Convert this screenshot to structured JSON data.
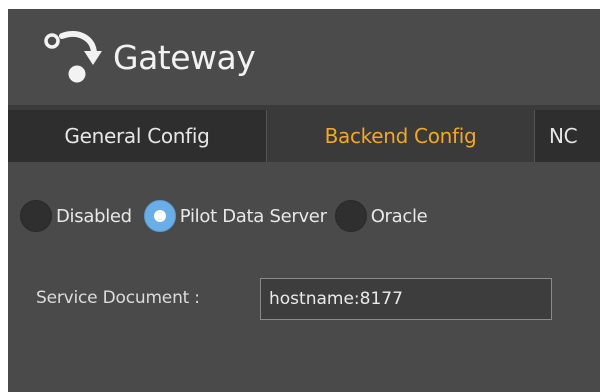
{
  "app": {
    "title": "Gateway",
    "logo_icon": "gateway-arrow-icon"
  },
  "tabs": [
    {
      "label": "General Config",
      "active": false
    },
    {
      "label": "Backend Config",
      "active": true
    },
    {
      "label": "NC",
      "active": false
    }
  ],
  "backend": {
    "mode_options": [
      {
        "label": "Disabled",
        "checked": false
      },
      {
        "label": "Pilot Data Server",
        "checked": true
      },
      {
        "label": "Oracle",
        "checked": false
      }
    ],
    "service_document": {
      "label": "Service Document :",
      "value": "hostname:8177"
    }
  },
  "colors": {
    "accent": "#f5a623",
    "radio_checked": "#6aaee8",
    "panel": "#4a4a4a"
  }
}
